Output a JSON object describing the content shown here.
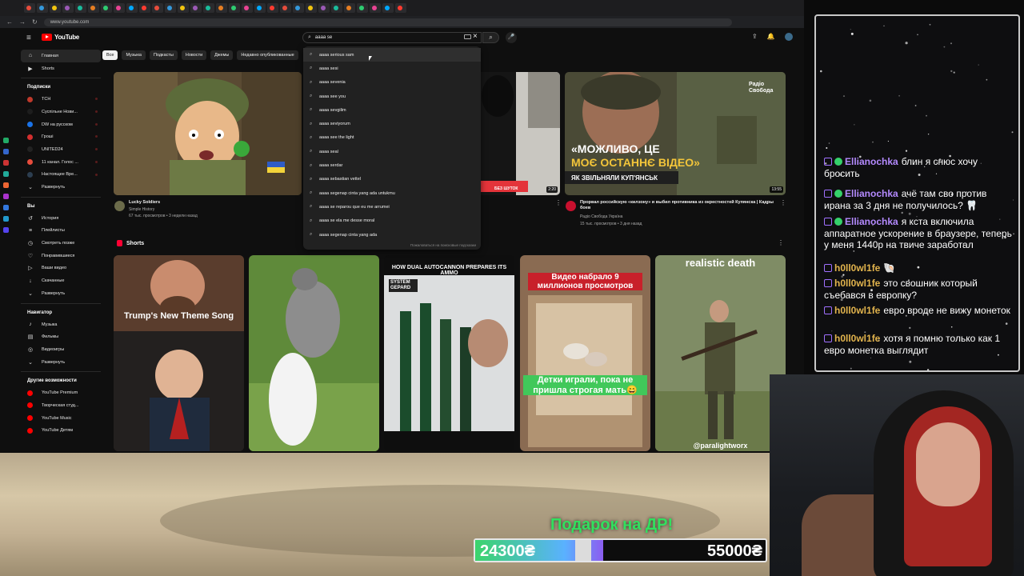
{
  "browser": {
    "url": "www.youtube.com",
    "tabs": [
      "",
      "",
      "",
      "",
      "",
      "",
      "",
      "",
      "",
      "",
      "",
      "",
      "",
      "",
      "",
      "",
      "",
      "",
      "",
      "",
      "",
      "",
      "",
      "",
      "",
      "",
      "",
      "",
      "",
      ""
    ]
  },
  "header": {
    "logo_text": "YouTube",
    "search_value": "aaaa se"
  },
  "search_suggestions": [
    "aaaa serious sam",
    "aaaa sesi",
    "aaaa sevenia",
    "aaaa see you",
    "aaaa sevgilim",
    "aaaa seviyorum",
    "aaaa see the light",
    "aaaa seal",
    "aaaa serdar",
    "aaaa sebastian vettel",
    "aaaa segenap cinta yang ada untukmu",
    "aaaa se reparou que eu me arrumei",
    "aaaa se ela me desse moral",
    "aaaa segenap cinta yang ada"
  ],
  "search_report_link": "Пожаловаться на поисковые подсказки",
  "sidebar": {
    "main": [
      {
        "icon": "home-icon",
        "label": "Главная"
      },
      {
        "icon": "shorts-icon",
        "label": "Shorts"
      }
    ],
    "subscriptions_title": "Подписки",
    "subscriptions": [
      {
        "label": "ТСН",
        "color": "#c0392b"
      },
      {
        "label": "Суспільне Нови...",
        "color": "#1d1d1d"
      },
      {
        "label": "DW на русском",
        "color": "#1a73e8"
      },
      {
        "label": "Гроші",
        "color": "#d32f2f"
      },
      {
        "label": "UNITED24",
        "color": "#222222"
      },
      {
        "label": "11 канал. Голос ...",
        "color": "#e74c3c"
      },
      {
        "label": "Настоящее Вре...",
        "color": "#2c3e50"
      }
    ],
    "expand_label": "Развернуть",
    "you_title": "Вы",
    "you_items": [
      {
        "icon": "history-icon",
        "label": "История"
      },
      {
        "icon": "playlists-icon",
        "label": "Плейлисты"
      },
      {
        "icon": "watch-later-icon",
        "label": "Смотреть позже"
      },
      {
        "icon": "liked-icon",
        "label": "Понравившиеся"
      },
      {
        "icon": "your-videos-icon",
        "label": "Ваши видео"
      },
      {
        "icon": "downloads-icon",
        "label": "Скачанные"
      },
      {
        "icon": "expand-icon",
        "label": "Развернуть"
      }
    ],
    "navigator_title": "Навигатор",
    "navigator_items": [
      {
        "icon": "music-icon",
        "label": "Музыка"
      },
      {
        "icon": "films-icon",
        "label": "Фильмы"
      },
      {
        "icon": "games-icon",
        "label": "Видеоигры"
      },
      {
        "icon": "expand-icon",
        "label": "Развернуть"
      }
    ],
    "more_title": "Другие возможности",
    "more_items": [
      {
        "label": "YouTube Premium",
        "color": "#ff0000"
      },
      {
        "label": "Творческая студ...",
        "color": "#ff0000"
      },
      {
        "label": "YouTube Music",
        "color": "#ff0000"
      },
      {
        "label": "YouTube Детям",
        "color": "#ff0000"
      }
    ]
  },
  "chips": [
    "Все",
    "Музыка",
    "Подкасты",
    "Новости",
    "Джемы",
    "Недавно опубликованные"
  ],
  "videos": [
    {
      "title": "Lucky Soldiers",
      "channel": "Simple History",
      "meta": "67 тыс. просмотров • 3 недели назад",
      "duration": ""
    },
    {
      "title": "",
      "channel": "",
      "meta": "",
      "duration": "2:20",
      "badge": "БЕЗ ШУТОК"
    },
    {
      "title": "Прорвал российскую «килзону» и выбил противника из окрестностей Купянска | Кадры боев",
      "channel": "Радіо Свобода Україна",
      "meta": "15 тыс. просмотров • 3 дня назад",
      "duration": "13:55",
      "overlay_line1": "«МОЖЛИВО, ЦЕ",
      "overlay_line2": "МОЄ ОСТАННЄ ВІДЕО»",
      "overlay_line3": "ЯК ЗВІЛЬНЯЛИ КУП'ЯНСЬК",
      "logo": "Радіо Свобода"
    }
  ],
  "shorts": {
    "title": "Shorts",
    "items": [
      {
        "caption": "Trump's New Theme Song"
      },
      {
        "caption": ""
      },
      {
        "caption": "HOW DUAL AUTOCANNON PREPARES ITS AMMO",
        "tag": "SYSTEM GEPARD"
      },
      {
        "caption": "Видео набрало 9 миллионов просмотров",
        "bottom": "Детки играли, пока не пришла строгая мать😄"
      },
      {
        "caption": "realistic death",
        "bottom": "@paralightworx"
      }
    ]
  },
  "chat": [
    {
      "nick": "Ellianochka",
      "text": "блин я снюс хочу бросить",
      "style": "e"
    },
    {
      "nick": "Ellianochka",
      "text": "ачё там сво против ирана за 3 дня не получилось? 🦷",
      "style": "e"
    },
    {
      "nick": "Ellianochka",
      "text": "я кста включила аппаратное ускорение в браузере, теперь у меня 1440p на твиче заработал",
      "style": "e"
    },
    {
      "nick": "h0ll0wl1fe",
      "text": "🐚",
      "style": "h"
    },
    {
      "nick": "h0ll0wl1fe",
      "text": "это свошник который съебався в европку?",
      "style": "h"
    },
    {
      "nick": "h0ll0wl1fe",
      "text": "евро вроде не вижу монеток",
      "style": "h"
    },
    {
      "nick": "h0ll0wl1fe",
      "text": "хотя я помню только как 1 евро монетка выглядит",
      "style": "h"
    }
  ],
  "donation_goal": {
    "title": "Подарок на ДР!",
    "current": "24300₴",
    "target": "55000₴",
    "progress": 0.44
  }
}
